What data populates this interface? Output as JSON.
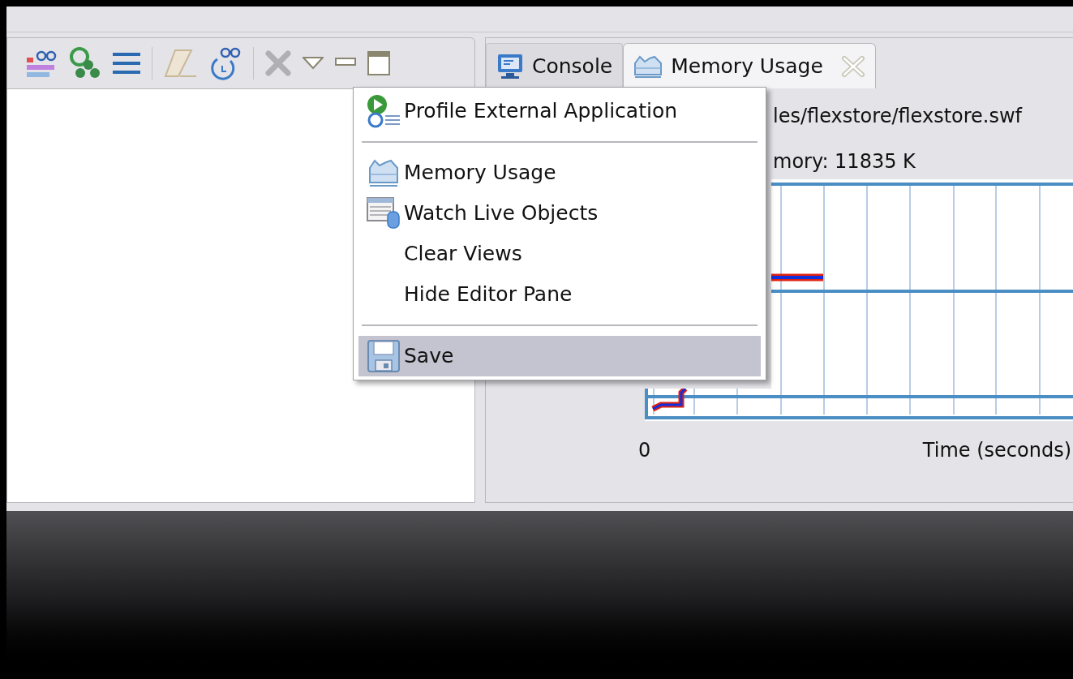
{
  "tabs": [
    {
      "label": "Console",
      "selected": false,
      "closable": false
    },
    {
      "label": "Memory Usage",
      "selected": true,
      "closable": true
    }
  ],
  "memory_view": {
    "path": "les/flexstore/flexstore.swf",
    "memory": "mory: 11835 K",
    "x_axis_start": "0",
    "x_axis_label": "Time (seconds)"
  },
  "menu": {
    "items": [
      {
        "kind": "item",
        "label": "Profile External Application",
        "selected": false
      },
      {
        "kind": "separator"
      },
      {
        "kind": "item",
        "label": "Memory Usage",
        "selected": false
      },
      {
        "kind": "item",
        "label": "Watch Live Objects",
        "selected": false
      },
      {
        "kind": "item",
        "label": "Clear Views",
        "selected": false
      },
      {
        "kind": "item",
        "label": "Hide Editor Pane",
        "selected": false
      },
      {
        "kind": "separator"
      },
      {
        "kind": "item",
        "label": "Save",
        "selected": true
      }
    ]
  }
}
